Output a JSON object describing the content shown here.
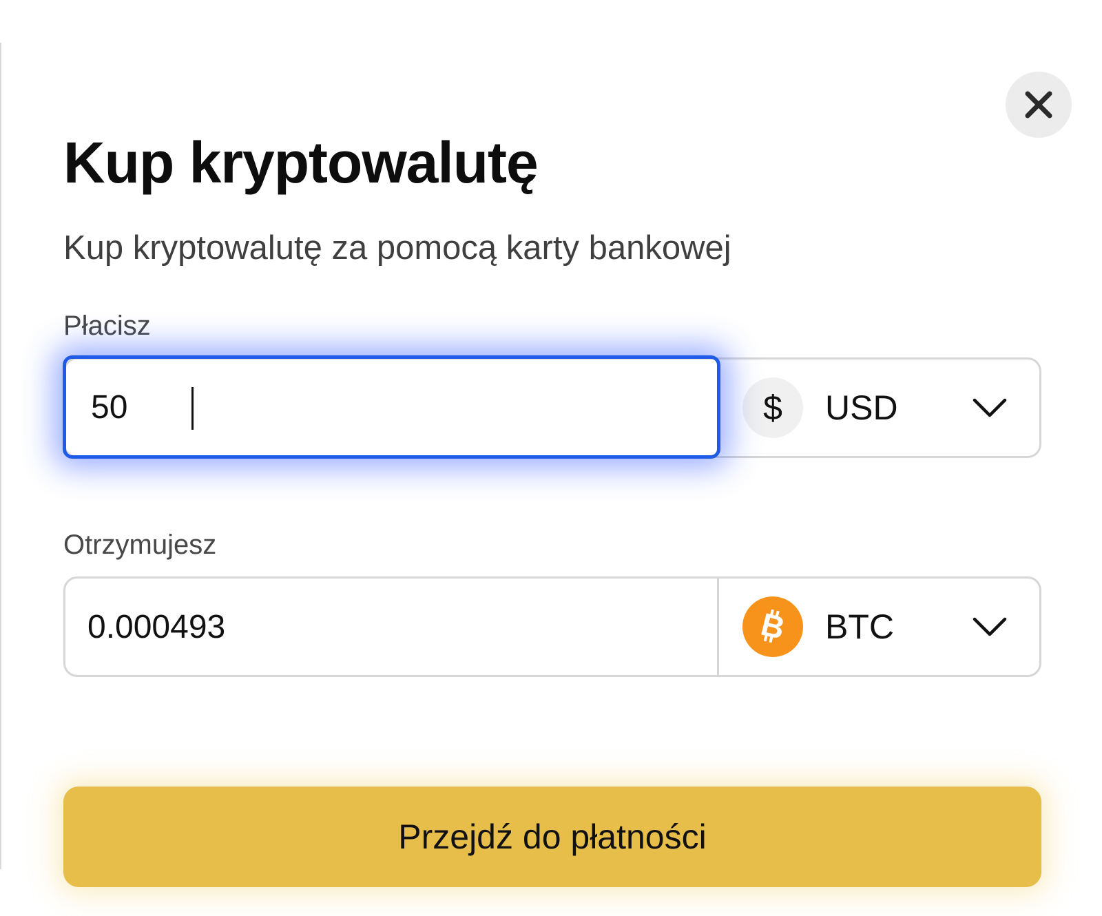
{
  "dialog": {
    "title": "Kup kryptowalutę",
    "subtitle": "Kup kryptowalutę za pomocą karty bankowej",
    "close_icon": "close-icon"
  },
  "pay": {
    "label": "Płacisz",
    "amount": "50",
    "currency_symbol": "$",
    "currency_code": "USD",
    "focused": true,
    "focus_color": "#1e5be6"
  },
  "receive": {
    "label": "Otrzymujesz",
    "amount": "0.000493",
    "currency_code": "BTC",
    "coin_icon": "bitcoin-icon",
    "coin_color": "#f7931a"
  },
  "actions": {
    "proceed_label": "Przejdź do płatności",
    "proceed_color": "#e8be4b"
  }
}
